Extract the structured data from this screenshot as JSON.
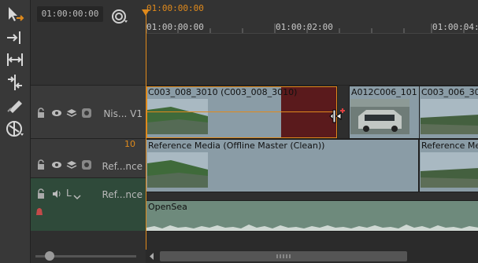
{
  "header": {
    "timecode": "01:00:00:00",
    "playhead_timecode": "01:00:00:00",
    "ruler": {
      "labels": [
        "01:00:00:00",
        "01:00:02:00",
        "01:00:04:"
      ]
    }
  },
  "tools": [
    "select-tool",
    "insert-tool",
    "fit-tool",
    "spacing-tool",
    "razor-tool",
    "nuke-tool"
  ],
  "tracks": {
    "v1": {
      "name": "Nis... V1",
      "clips": [
        {
          "label": "C003_008_3010 (C003_008_3010)"
        },
        {
          "label": "A012C006_101"
        },
        {
          "label": "C003_006_30"
        }
      ]
    },
    "v2": {
      "name": "Ref...nce",
      "marker": "10",
      "clips": [
        {
          "label": "Reference Media (Offline Master (Clean))"
        },
        {
          "label": "Reference Me"
        }
      ]
    },
    "a1": {
      "name": "Ref...nce",
      "channel": "L",
      "clip_label": "OpenSea"
    }
  },
  "colors": {
    "accent": "#e08a1c",
    "clip": "#8a9ca6",
    "selected_tail": "#5a1a1c",
    "audio_track": "#2f4a3a"
  }
}
